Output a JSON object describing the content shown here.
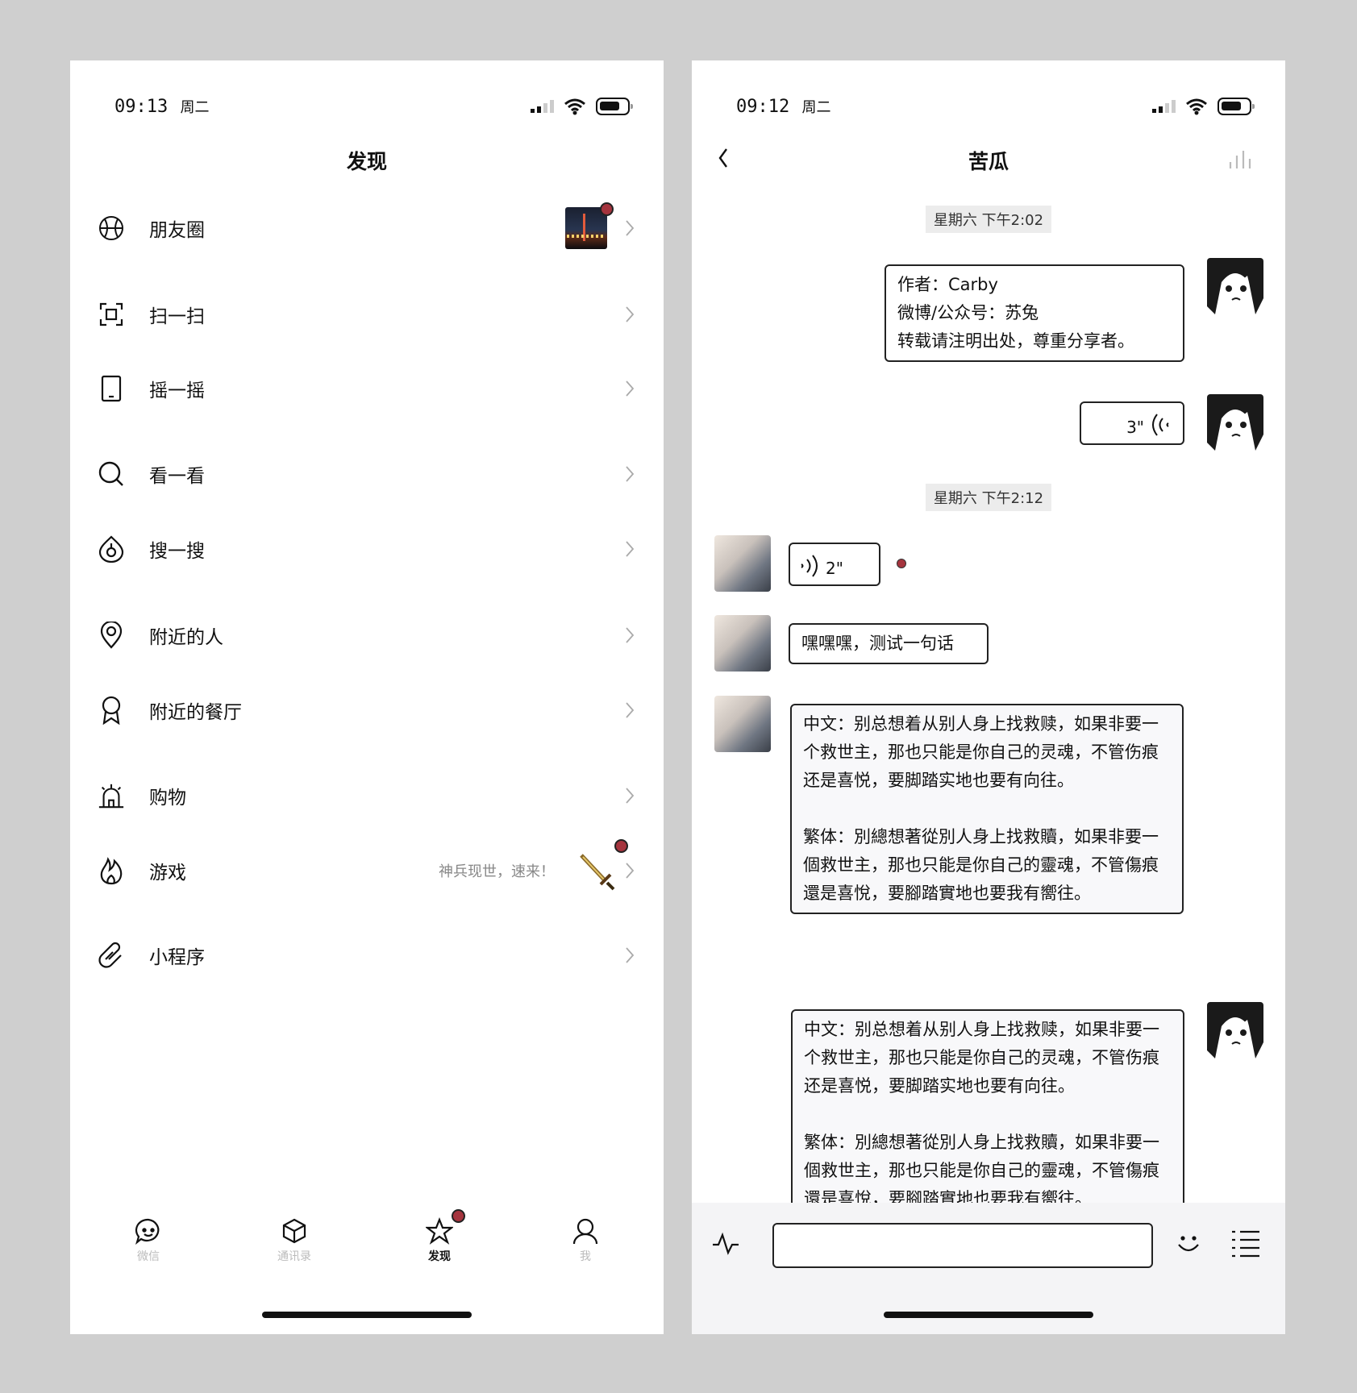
{
  "discover_screen": {
    "status": {
      "time": "09:13",
      "day": "周二"
    },
    "title": "发现",
    "items": [
      {
        "label": "朋友圈",
        "icon": "aperture-icon"
      },
      {
        "label": "扫一扫",
        "icon": "scan-icon"
      },
      {
        "label": "摇一摇",
        "icon": "phone-shake-icon"
      },
      {
        "label": "看一看",
        "icon": "search-look-icon"
      },
      {
        "label": "搜一搜",
        "icon": "search-drop-icon"
      },
      {
        "label": "附近的人",
        "icon": "location-pin-icon"
      },
      {
        "label": "附近的餐厅",
        "icon": "badge-icon"
      },
      {
        "label": "购物",
        "icon": "shopping-icon"
      },
      {
        "label": "游戏",
        "icon": "flame-icon",
        "promo": "神兵现世，速来！"
      },
      {
        "label": "小程序",
        "icon": "link-icon"
      }
    ],
    "tabs": [
      {
        "label": "微信",
        "icon": "chat-bubble-icon",
        "active": false
      },
      {
        "label": "通讯录",
        "icon": "cube-icon",
        "active": false
      },
      {
        "label": "发现",
        "icon": "star-icon",
        "active": true
      },
      {
        "label": "我",
        "icon": "person-icon",
        "active": false
      }
    ]
  },
  "chat_screen": {
    "status": {
      "time": "09:12",
      "day": "周二"
    },
    "title": "苦瓜",
    "timestamps": [
      "星期六 下午2:02",
      "星期六 下午2:12"
    ],
    "messages": [
      {
        "from": "me",
        "type": "text",
        "text": "作者：Carby\n微博/公众号：苏兔\n转载请注明出处，尊重分享者。"
      },
      {
        "from": "me",
        "type": "voice",
        "duration": "3\""
      },
      {
        "from": "them",
        "type": "voice",
        "duration": "2\"",
        "unread": true
      },
      {
        "from": "them",
        "type": "text",
        "text": "嘿嘿嘿，测试一句话"
      },
      {
        "from": "them",
        "type": "text",
        "text": "中文：别总想着从别人身上找救赎，如果非要一个救世主，那也只能是你自己的灵魂，不管伤痕还是喜悦，要脚踏实地也要有向往。\n\n繁体：別總想著從別人身上找救贖，如果非要一個救世主，那也只能是你自己的靈魂，不管傷痕還是喜悅，要腳踏實地也要我有嚮往。"
      },
      {
        "from": "me",
        "type": "text",
        "text": "中文：别总想着从别人身上找救赎，如果非要一个救世主，那也只能是你自己的灵魂，不管伤痕还是喜悦，要脚踏实地也要有向往。\n\n繁体：別總想著從別人身上找救贖，如果非要一個救世主，那也只能是你自己的靈魂，不管傷痕還是喜悅，要腳踏實地也要我有嚮往。"
      }
    ],
    "input": {
      "value": "",
      "placeholder": ""
    }
  },
  "colors": {
    "accent_dot": "#a5343e",
    "background": "#cfcfcf",
    "timestamp_bg": "#ececec"
  }
}
